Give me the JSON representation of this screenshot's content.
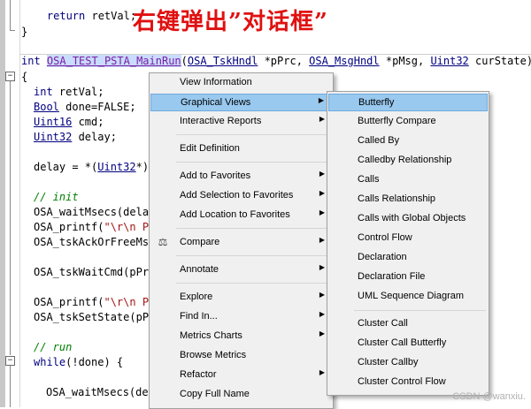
{
  "annotation": "右键弹出”对话框”",
  "code": {
    "l_return": "    return retVal;",
    "l_close": "}",
    "sig_kw": "int",
    "sig_fn": "OSA_TEST_PSTA_MainRun",
    "sig_t1": "OSA_TskHndl",
    "sig_p1": " *pPrc, ",
    "sig_t2": "OSA_MsgHndl",
    "sig_p2": " *pMsg, ",
    "sig_t3": "Uint32",
    "sig_p3": " curState)",
    "l_open": "{",
    "l1_kw": "int",
    "l1_rest": " retVal;",
    "l2_ty": "Bool",
    "l2_rest": " done=FALSE;",
    "l3_ty": "Uint16",
    "l3_rest": " cmd;",
    "l4_ty": "Uint32",
    "l4_rest": " delay;",
    "l5_a": "delay = *(",
    "l5_ty": "Uint32",
    "l5_b": "*)C",
    "l6_cm": "// init",
    "l7": "OSA_waitMsecs(delay",
    "l8_a": "OSA_printf(",
    "l8_st": "\"\\r\\n PS",
    "l9": "OSA_tskAckOrFreeMsg",
    "l10": "OSA_tskWaitCmd(pPrc",
    "l11_a": "OSA_printf(",
    "l11_st": "\"\\r\\n PS",
    "l12": "OSA_tskSetState(pPr",
    "l13_cm": "// run",
    "l14_a": "while",
    "l14_b": "(!done) {",
    "l15": "OSA_waitMsecs(del"
  },
  "context_menu": {
    "items": [
      {
        "label": "View Information"
      },
      {
        "label": "Graphical Views",
        "submenu": true,
        "highlighted": true
      },
      {
        "label": "Interactive Reports",
        "submenu": true
      },
      {
        "label": "Edit Definition"
      },
      {
        "label": "Add to Favorites",
        "submenu": true
      },
      {
        "label": "Add Selection to Favorites",
        "submenu": true
      },
      {
        "label": "Add Location to Favorites",
        "submenu": true
      },
      {
        "label": "Compare",
        "submenu": true,
        "icon": "compare-icon"
      },
      {
        "label": "Annotate",
        "submenu": true
      },
      {
        "label": "Explore",
        "submenu": true
      },
      {
        "label": "Find In...",
        "submenu": true
      },
      {
        "label": "Metrics Charts",
        "submenu": true
      },
      {
        "label": "Browse Metrics"
      },
      {
        "label": "Refactor",
        "submenu": true
      },
      {
        "label": "Copy Full Name"
      }
    ]
  },
  "submenu": {
    "items": [
      {
        "label": "Butterfly",
        "highlighted": true
      },
      {
        "label": "Butterfly Compare"
      },
      {
        "label": "Called By"
      },
      {
        "label": "Calledby Relationship"
      },
      {
        "label": "Calls"
      },
      {
        "label": "Calls Relationship"
      },
      {
        "label": "Calls with Global Objects"
      },
      {
        "label": "Control Flow"
      },
      {
        "label": "Declaration"
      },
      {
        "label": "Declaration File"
      },
      {
        "label": "UML Sequence Diagram"
      },
      {
        "label": "Cluster Call"
      },
      {
        "label": "Cluster Call Butterfly"
      },
      {
        "label": "Cluster Callby"
      },
      {
        "label": "Cluster Control Flow"
      }
    ]
  },
  "watermark": "CSDN @wanxiu.",
  "colors": {
    "highlight": "#99c9ef",
    "annotation": "#e01010",
    "keyword": "#000080",
    "function": "#7a1fa2",
    "comment": "#008000"
  }
}
